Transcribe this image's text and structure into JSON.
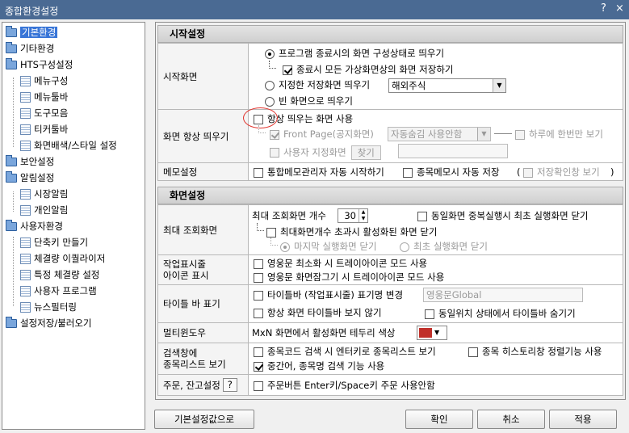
{
  "window": {
    "title": "종합환경설정",
    "help_glyph": "?",
    "close_glyph": "×"
  },
  "tree": [
    {
      "label": "기본환경",
      "selected": true
    },
    {
      "label": "기타환경"
    },
    {
      "label": "HTS구성설정"
    },
    {
      "label": "메뉴구성"
    },
    {
      "label": "메뉴툴바"
    },
    {
      "label": "도구모음"
    },
    {
      "label": "티커툴바"
    },
    {
      "label": "화면배색/스타일 설정"
    },
    {
      "label": "보안설정"
    },
    {
      "label": "알림설정"
    },
    {
      "label": "시장알림"
    },
    {
      "label": "개인알림"
    },
    {
      "label": "사용자환경"
    },
    {
      "label": "단축키 만들기"
    },
    {
      "label": "체결량 이퀄라이저"
    },
    {
      "label": "특정 체결량 설정"
    },
    {
      "label": "사용자 프로그램"
    },
    {
      "label": "뉴스필터링"
    },
    {
      "label": "설정저장/불러오기"
    }
  ],
  "sections": {
    "start": "시작설정",
    "screen": "화면설정"
  },
  "start_screen": {
    "label": "시작화면",
    "opt_program": "프로그램 종료시의 화면 구성상태로 띄우기",
    "opt_save_virtual": "종료시 모든 가상화면상의 화면 저장하기",
    "opt_saved_screen": "지정한 저장화면 띄우기",
    "saved_screen_value": "해외주식",
    "opt_blank": "빈 화면으로 띄우기"
  },
  "always_on": {
    "label": "화면 항상 띄우기",
    "opt_always": "항상 띄우는 화면 사용",
    "front_page": "Front Page(공지화면)",
    "front_combo": "자동숨김 사용안함",
    "once_day": "하루에 한번만 보기",
    "user_screen": "사용자 지정화면",
    "find_btn": "찾기"
  },
  "memo": {
    "label": "메모설정",
    "opt_auto": "통합메모관리자 자동 시작하기",
    "opt_save": "종목메모시 자동 저장",
    "paren_open": "(",
    "opt_confirm": "저장확인창 보기",
    "paren_close": ")"
  },
  "max_view": {
    "label": "최대 조회화면",
    "count_label": "최대 조회화면 개수",
    "count_value": "30",
    "dup_close": "동일화면 중복실행시 최초 실행화면 닫기",
    "exceed_close": "최대화면개수 초과시 활성화된 화면 닫기",
    "last_close": "마지막 실행화면 닫기",
    "first_close": "최초 실행화면 닫기"
  },
  "tray": {
    "label1": "작업표시줄",
    "label2": "아이콘 표시",
    "opt_min": "영웅문 최소화 시 트레이아이콘 모드 사용",
    "opt_lock": "영웅문 화면잠그기 시 트레이아이콘 모드 사용"
  },
  "titlebar_view": {
    "label": "타이틀 바 표기",
    "opt_change": "타이틀바 (작업표시줄) 표기명 변경",
    "change_value": "영웅문Global",
    "opt_always": "항상 화면 타이틀바 보지 않기",
    "opt_same_pos": "동일위치 상태에서 타이틀바 숨기기"
  },
  "multi": {
    "label": "멀티윈도우",
    "text": "MxN 화면에서 활성화면 테두리 색상",
    "color": "#c0302a"
  },
  "search": {
    "label1": "검색창에",
    "label2": "종목리스트 보기",
    "opt_enter": "종목코드 검색 시 엔터키로 종목리스트 보기",
    "opt_history": "종목 히스토리창 정렬기능 사용",
    "opt_mid": "중간어, 종목명 검색 기능 사용"
  },
  "order": {
    "label": "주문, 잔고설정",
    "help_glyph": "?",
    "opt_enter": "주문버튼 Enter키/Space키 주문 사용안함"
  },
  "buttons": {
    "defaults": "기본설정값으로",
    "ok": "확인",
    "cancel": "취소",
    "apply": "적용"
  }
}
